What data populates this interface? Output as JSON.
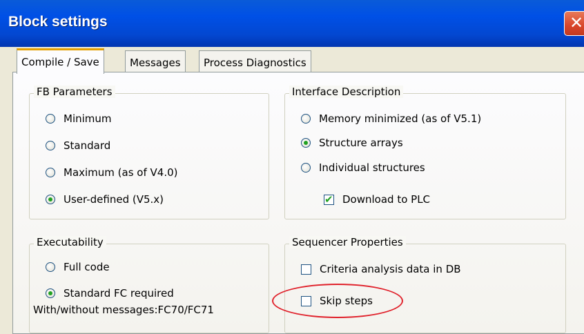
{
  "window": {
    "title": "Block settings",
    "close_glyph": "✕"
  },
  "tabs": [
    {
      "label": "Compile / Save",
      "active": true
    },
    {
      "label": "Messages",
      "active": false
    },
    {
      "label": "Process Diagnostics",
      "active": false
    }
  ],
  "fb_parameters": {
    "label": "FB Parameters",
    "options": [
      {
        "label": "Minimum",
        "selected": false
      },
      {
        "label": "Standard",
        "selected": false
      },
      {
        "label": "Maximum (as of V4.0)",
        "selected": false
      },
      {
        "label": "User-defined (V5.x)",
        "selected": true
      }
    ]
  },
  "interface_description": {
    "label": "Interface Description",
    "options": [
      {
        "label": "Memory minimized (as of V5.1)",
        "selected": false
      },
      {
        "label": "Structure arrays",
        "selected": true
      },
      {
        "label": "Individual structures",
        "selected": false
      }
    ],
    "download_label": "Download to PLC",
    "download_checked": true
  },
  "executability": {
    "label": "Executability",
    "options": [
      {
        "label": "Full code",
        "selected": false
      },
      {
        "label": "Standard FC required",
        "selected": true
      }
    ],
    "note": "With/without messages:FC70/FC71"
  },
  "sequencer_properties": {
    "label": "Sequencer Properties",
    "criteria_label": "Criteria analysis data in DB",
    "criteria_checked": false,
    "skip_label": "Skip steps",
    "skip_checked": false
  },
  "colors": {
    "titlebar": "#0050e6",
    "radio_dot": "#21a121",
    "highlight": "#e0202a"
  }
}
